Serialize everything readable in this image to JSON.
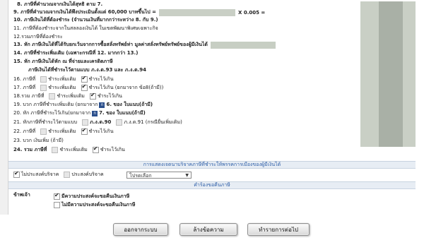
{
  "form": {
    "item8": "8. ภาษีที่คำนวณจากเงินได้สุทธิ ตาม 7.",
    "item9": "9. ภาษีที่คำนวณจากเงินได้พึงประเมินตั้งแต่ 60,000 บาทขึ้นไป =",
    "item9_mult": "X 0.005 =",
    "item10": "10. ภาษีเงินได้ที่ต้องชำระ (จำนวนเงินที่มากกว่าระหว่าง 8. กับ 9.)",
    "item11": "11. ภาษีที่ต้องชำระจากในสลลองเงินได้ ในเขตพัฒนาพิเศษเฉพาะกิจ",
    "item12": "12.รวมภาษีที่ต้องชำระ",
    "item13": "13. หัก ภาษีเงินได้ที่ได้รับยกเว้นจากการซื้อสลั่งทรัพย์ห่า มูลค่าสลั่งทรัพย์ทรัพย์ของผู้มีเงินได้",
    "item14": "14. ภาษีที่ชำระเพิ่มเติม (เฉพาะกรณีที่ 12. มากกว่า 13.)",
    "item15": "15. หัก ภาษีเงินได้หัก ณ ที่จ่ายและเครดิตภาษี",
    "item15_sub": "ภาษีเงินได้ที่ชำระไว้ตามแบบ ภ.ง.ด.93 และ ภ.ง.ด.94",
    "item16_prefix": "16. ภาษีที่",
    "item17_prefix": "17. ภาษีที่",
    "item18_prefix": "18.รวม ภาษีที่",
    "item19_prefix": "19. บวก ภาษีที่ชำระเพิ่มเติม (ยกมาจาก",
    "item19_suffix": "6. ของ ใบแนบ(ถ้ามี)",
    "item20_prefix": "20. หัก ภาษีที่ชำระไว้เกิน(ยกมาจาก",
    "item20_suffix": "7. ของ ใบแนบ(ถ้ามี)",
    "item21_prefix": "21. หักภาษีที่ชำระไว้ตามแบบ",
    "item21_a": "ภ.ง.ด.90",
    "item21_b": "ภ.ง.ด.91 (กรณียื่นเพิ่มเติม)",
    "item22_prefix": "22. ภาษีที่",
    "item23": "23. บวก เงินเพิ่ม (ถ้ามี)",
    "item24_prefix": "24. รวม ภาษีที่",
    "opt_extra": "ชำระเพิ่มเติม",
    "opt_over": "ชำระไว้เกิน",
    "opt_over_more": "ชำระไว้เกิน (ยกมาจาก ข้อ8(ถ้ามี))"
  },
  "donation": {
    "section_title": "การแสดงเจตนาบริจาคภาษีที่ชำระให้พรรคการเมืองของผู้มีเงินได้",
    "no_label": "ไม่ประสงค์บริจาค",
    "yes_label": "ประสงค์บริจาค",
    "select_placeholder": "โปรดเลือก"
  },
  "refund": {
    "section_title": "คำร้องขอคืนภาษี",
    "owner_label": "ข้าพเจ้า",
    "want_label": "มีความประสงค์จะขอคืนเงินภาษี",
    "not_want_label": "ไม่มีความประสงค์จะขอคืนเงินภาษี"
  },
  "buttons": {
    "exit": "ออกจากระบบ",
    "clear": "ล้างข้อความ",
    "next": "ทำรายการต่อไป"
  }
}
